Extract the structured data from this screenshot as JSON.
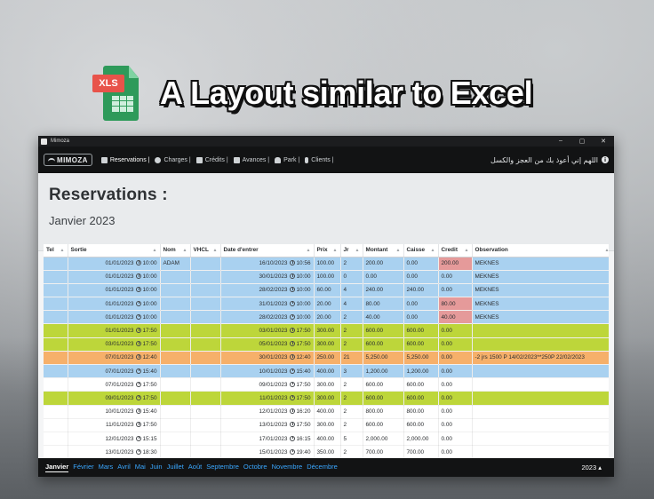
{
  "hero": {
    "badge": "XLS",
    "title": "A Layout similar to Excel"
  },
  "window": {
    "title": "Mimoza",
    "controls": [
      "–",
      "▢",
      "✕"
    ]
  },
  "navbar": {
    "logo": "MIMOZA",
    "items": [
      {
        "label": "Reservations |",
        "icon": "calendar-icon"
      },
      {
        "label": "Charges |",
        "icon": "money-icon"
      },
      {
        "label": "Crédits |",
        "icon": "credit-icon"
      },
      {
        "label": "Avances |",
        "icon": "download-icon"
      },
      {
        "label": "Park |",
        "icon": "car-icon"
      },
      {
        "label": "Clients |",
        "icon": "person-icon"
      }
    ],
    "right_text": "اللهم إني أعوذ بك من العجز والكسل"
  },
  "page": {
    "title": "Reservations :",
    "subtitle": "Janvier 2023"
  },
  "table": {
    "columns": [
      "Tel",
      "Sortie",
      "Nom",
      "VHCL",
      "Date d'entrer",
      "Prix",
      "Jr",
      "Montant",
      "Caisse",
      "Credit",
      "Observation"
    ],
    "rows": [
      {
        "color": "blue",
        "tel": "",
        "sortie_date": "01/01/2023",
        "sortie_time": "10:00",
        "nom": "ADAM",
        "vhcl": "",
        "entree_date": "16/10/2023",
        "entree_time": "10:56",
        "prix": "100.00",
        "jr": "2",
        "montant": "200.00",
        "caisse": "0.00",
        "credit": "200.00",
        "credit_red": true,
        "observation": "MEKNES"
      },
      {
        "color": "blue",
        "tel": "",
        "sortie_date": "01/01/2023",
        "sortie_time": "10:00",
        "nom": "",
        "vhcl": "",
        "entree_date": "30/01/2023",
        "entree_time": "10:00",
        "prix": "100.00",
        "jr": "0",
        "montant": "0.00",
        "caisse": "0.00",
        "credit": "0.00",
        "credit_red": false,
        "observation": "MEKNES"
      },
      {
        "color": "blue",
        "tel": "",
        "sortie_date": "01/01/2023",
        "sortie_time": "10:00",
        "nom": "",
        "vhcl": "",
        "entree_date": "28/02/2023",
        "entree_time": "10:00",
        "prix": "60.00",
        "jr": "4",
        "montant": "240.00",
        "caisse": "240.00",
        "credit": "0.00",
        "credit_red": false,
        "observation": "MEKNES"
      },
      {
        "color": "blue",
        "tel": "",
        "sortie_date": "01/01/2023",
        "sortie_time": "10:00",
        "nom": "",
        "vhcl": "",
        "entree_date": "31/01/2023",
        "entree_time": "10:00",
        "prix": "20.00",
        "jr": "4",
        "montant": "80.00",
        "caisse": "0.00",
        "credit": "80.00",
        "credit_red": true,
        "observation": "MEKNES"
      },
      {
        "color": "blue",
        "tel": "",
        "sortie_date": "01/01/2023",
        "sortie_time": "10:00",
        "nom": "",
        "vhcl": "",
        "entree_date": "28/02/2023",
        "entree_time": "10:00",
        "prix": "20.00",
        "jr": "2",
        "montant": "40.00",
        "caisse": "0.00",
        "credit": "40.00",
        "credit_red": true,
        "observation": "MEKNES"
      },
      {
        "color": "green",
        "tel": "",
        "sortie_date": "01/01/2023",
        "sortie_time": "17:50",
        "nom": "",
        "vhcl": "",
        "entree_date": "03/01/2023",
        "entree_time": "17:50",
        "prix": "300.00",
        "jr": "2",
        "montant": "600.00",
        "caisse": "600.00",
        "credit": "0.00",
        "credit_red": false,
        "observation": ""
      },
      {
        "color": "green",
        "tel": "",
        "sortie_date": "03/01/2023",
        "sortie_time": "17:50",
        "nom": "",
        "vhcl": "",
        "entree_date": "05/01/2023",
        "entree_time": "17:50",
        "prix": "300.00",
        "jr": "2",
        "montant": "600.00",
        "caisse": "600.00",
        "credit": "0.00",
        "credit_red": false,
        "observation": ""
      },
      {
        "color": "orange",
        "tel": "",
        "sortie_date": "07/01/2023",
        "sortie_time": "12:40",
        "nom": "",
        "vhcl": "",
        "entree_date": "30/01/2023",
        "entree_time": "12:40",
        "prix": "250.00",
        "jr": "21",
        "montant": "5,250.00",
        "caisse": "5,250.00",
        "credit": "0.00",
        "credit_red": false,
        "observation": "-2 jrs 1500 P 14/02/2023**250P 22/02/2023"
      },
      {
        "color": "blue",
        "tel": "",
        "sortie_date": "07/01/2023",
        "sortie_time": "15:40",
        "nom": "",
        "vhcl": "",
        "entree_date": "10/01/2023",
        "entree_time": "15:40",
        "prix": "400.00",
        "jr": "3",
        "montant": "1,200.00",
        "caisse": "1,200.00",
        "credit": "0.00",
        "credit_red": false,
        "observation": ""
      },
      {
        "color": "white",
        "tel": "",
        "sortie_date": "07/01/2023",
        "sortie_time": "17:50",
        "nom": "",
        "vhcl": "",
        "entree_date": "09/01/2023",
        "entree_time": "17:50",
        "prix": "300.00",
        "jr": "2",
        "montant": "600.00",
        "caisse": "600.00",
        "credit": "0.00",
        "credit_red": false,
        "observation": ""
      },
      {
        "color": "green",
        "tel": "",
        "sortie_date": "09/01/2023",
        "sortie_time": "17:50",
        "nom": "",
        "vhcl": "",
        "entree_date": "11/01/2023",
        "entree_time": "17:50",
        "prix": "300.00",
        "jr": "2",
        "montant": "600.00",
        "caisse": "600.00",
        "credit": "0.00",
        "credit_red": false,
        "observation": ""
      },
      {
        "color": "white",
        "tel": "",
        "sortie_date": "10/01/2023",
        "sortie_time": "15:40",
        "nom": "",
        "vhcl": "",
        "entree_date": "12/01/2023",
        "entree_time": "16:20",
        "prix": "400.00",
        "jr": "2",
        "montant": "800.00",
        "caisse": "800.00",
        "credit": "0.00",
        "credit_red": false,
        "observation": ""
      },
      {
        "color": "white",
        "tel": "",
        "sortie_date": "11/01/2023",
        "sortie_time": "17:50",
        "nom": "",
        "vhcl": "",
        "entree_date": "13/01/2023",
        "entree_time": "17:50",
        "prix": "300.00",
        "jr": "2",
        "montant": "600.00",
        "caisse": "600.00",
        "credit": "0.00",
        "credit_red": false,
        "observation": ""
      },
      {
        "color": "white",
        "tel": "",
        "sortie_date": "12/01/2023",
        "sortie_time": "15:15",
        "nom": "",
        "vhcl": "",
        "entree_date": "17/01/2023",
        "entree_time": "16:15",
        "prix": "400.00",
        "jr": "5",
        "montant": "2,000.00",
        "caisse": "2,000.00",
        "credit": "0.00",
        "credit_red": false,
        "observation": ""
      },
      {
        "color": "white",
        "tel": "",
        "sortie_date": "13/01/2023",
        "sortie_time": "18:30",
        "nom": "",
        "vhcl": "",
        "entree_date": "15/01/2023",
        "entree_time": "19:40",
        "prix": "350.00",
        "jr": "2",
        "montant": "700.00",
        "caisse": "700.00",
        "credit": "0.00",
        "credit_red": false,
        "observation": ""
      }
    ]
  },
  "months": [
    "Janvier",
    "Février",
    "Mars",
    "Avril",
    "Mai",
    "Juin",
    "Juillet",
    "Août",
    "Septembre",
    "Octobre",
    "Novembre",
    "Décembre"
  ],
  "active_month": "Janvier",
  "year": "2023 ▴",
  "colors": {
    "blue_row": "#a9d1f0",
    "green_row": "#bdd63a",
    "orange_row": "#f6b06a",
    "credit_red": "#e59a9a",
    "month_link": "#3aa7ff"
  }
}
